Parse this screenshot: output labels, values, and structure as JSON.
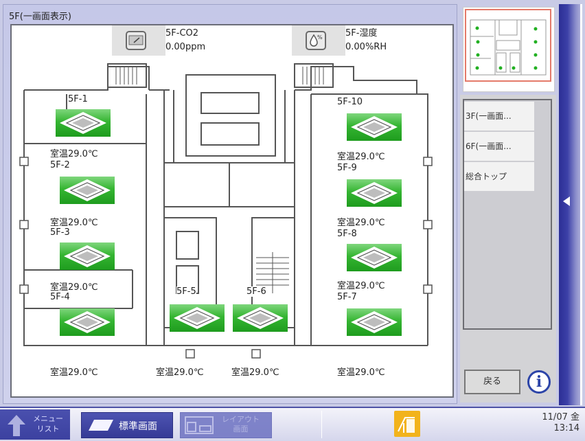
{
  "main": {
    "title": "5F(一画面表示)",
    "sensors": [
      {
        "name": "5F-CO2",
        "value": "0.00ppm",
        "icon": "co2-meter-icon"
      },
      {
        "name": "5F-湿度",
        "value": "0.00%RH",
        "icon": "humidity-drop-icon"
      }
    ],
    "units": [
      {
        "id": "5F-1",
        "temp": "室温29.0℃",
        "status_color": "#35b532"
      },
      {
        "id": "5F-2",
        "temp": "室温29.0℃",
        "status_color": "#35b532"
      },
      {
        "id": "5F-3",
        "temp": "室温29.0℃",
        "status_color": "#35b532"
      },
      {
        "id": "5F-4",
        "temp": "室温29.0℃",
        "status_color": "#35b532"
      },
      {
        "id": "5F-5",
        "temp": "室温29.0℃",
        "status_color": "#35b532"
      },
      {
        "id": "5F-6",
        "temp": "室温29.0℃",
        "status_color": "#35b532"
      },
      {
        "id": "5F-7",
        "temp": "室温29.0℃",
        "status_color": "#35b532"
      },
      {
        "id": "5F-8",
        "temp": "室温29.0℃",
        "status_color": "#35b532"
      },
      {
        "id": "5F-9",
        "temp": "室温29.0℃",
        "status_color": "#35b532"
      },
      {
        "id": "5F-10",
        "temp": "室温29.0℃",
        "status_color": "#35b532"
      }
    ]
  },
  "sidebar": {
    "nav_items": [
      {
        "label": "3F(一画面..."
      },
      {
        "label": "6F(一画面..."
      },
      {
        "label": "総合トップ"
      }
    ],
    "back_label": "戻る",
    "info_label": "i",
    "handle_icon": "collapse-arrow-left-icon"
  },
  "bottom": {
    "menu_line1": "メニュー",
    "menu_line2": "リスト",
    "standard_label": "標準画面",
    "layout_line1": "レイアウト",
    "layout_line2": "画面",
    "date": "11/07 金",
    "time": "13:14"
  },
  "colors": {
    "accent": "#3c41a0",
    "unit_on": "#35b532",
    "minimap_border": "#e47a6a",
    "door_icon": "#f2b31c"
  }
}
